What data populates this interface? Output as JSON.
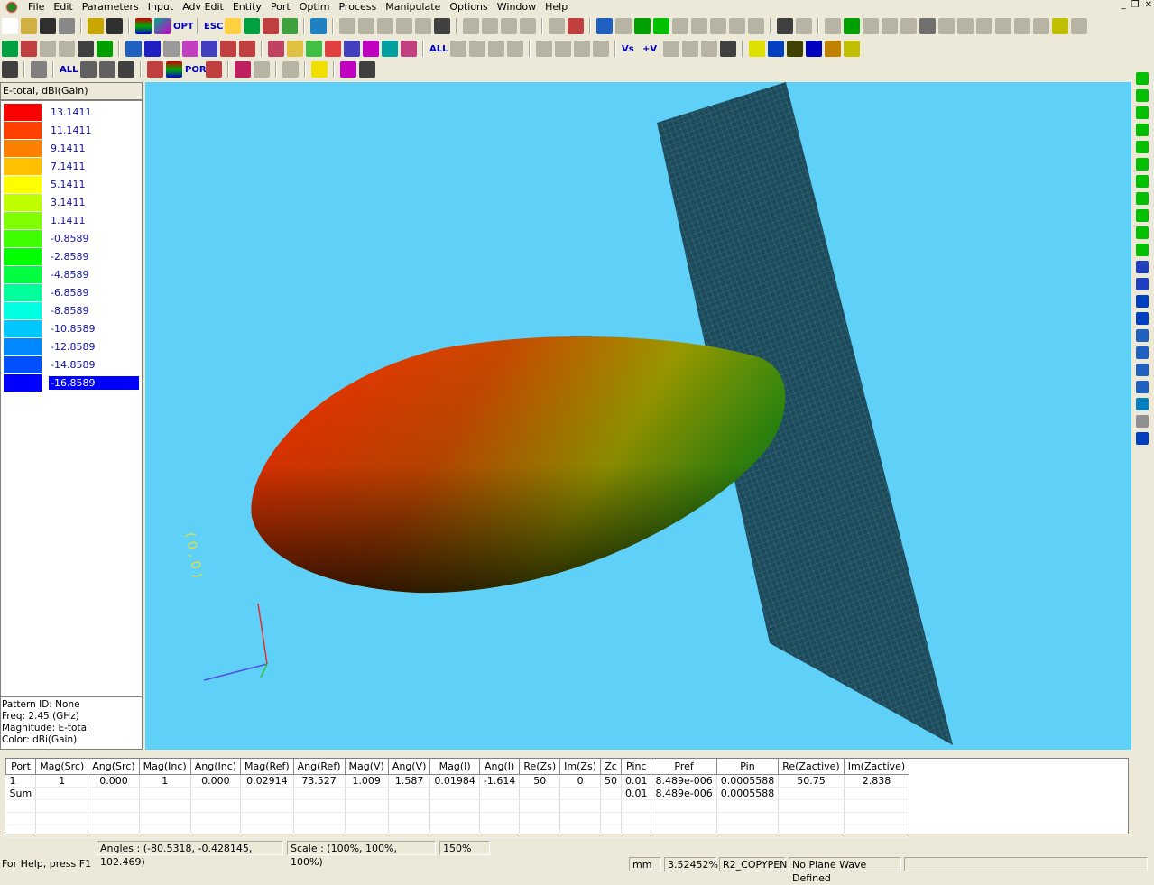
{
  "menu": [
    "File",
    "Edit",
    "Parameters",
    "Input",
    "Adv Edit",
    "Entity",
    "Port",
    "Optim",
    "Process",
    "Manipulate",
    "Options",
    "Window",
    "Help"
  ],
  "toolbar": {
    "opt_label": "OPT",
    "esc_label": "ESC",
    "all_label": "ALL",
    "port_label": "PORT",
    "vs_label": "Vs",
    "v_label": "+V"
  },
  "legend": {
    "title": "E-total, dBi(Gain)",
    "items": [
      {
        "value": "13.1411",
        "color": "#ff0000"
      },
      {
        "value": "11.1411",
        "color": "#ff4000"
      },
      {
        "value": "9.1411",
        "color": "#ff8000"
      },
      {
        "value": "7.1411",
        "color": "#ffc000"
      },
      {
        "value": "5.1411",
        "color": "#ffff00"
      },
      {
        "value": "3.1411",
        "color": "#c0ff00"
      },
      {
        "value": "1.1411",
        "color": "#80ff00"
      },
      {
        "value": "-0.8589",
        "color": "#40ff00"
      },
      {
        "value": "-2.8589",
        "color": "#00ff00"
      },
      {
        "value": "-4.8589",
        "color": "#00ff40"
      },
      {
        "value": "-6.8589",
        "color": "#00ff9a"
      },
      {
        "value": "-8.8589",
        "color": "#00ffe0"
      },
      {
        "value": "-10.8589",
        "color": "#00c8ff"
      },
      {
        "value": "-12.8589",
        "color": "#0088ff"
      },
      {
        "value": "-14.8589",
        "color": "#0050ff"
      },
      {
        "value": "-16.8589",
        "color": "#0000ff",
        "selected": true
      }
    ]
  },
  "info": {
    "pattern": "Pattern ID: None",
    "freq": "Freq: 2.45 (GHz)",
    "magnitude": "Magnitude: E-total",
    "color": "Color: dBi(Gain)"
  },
  "table": {
    "headers": [
      "Port",
      "Mag(Src)",
      "Ang(Src)",
      "Mag(Inc)",
      "Ang(Inc)",
      "Mag(Ref)",
      "Ang(Ref)",
      "Mag(V)",
      "Ang(V)",
      "Mag(I)",
      "Ang(I)",
      "Re(Zs)",
      "Im(Zs)",
      "Zc",
      "Pinc",
      "Pref",
      "Pin",
      "Re(Zactive)",
      "Im(Zactive)"
    ],
    "rows": [
      [
        "1",
        "1",
        "0.000",
        "1",
        "0.000",
        "0.02914",
        "73.527",
        "1.009",
        "1.587",
        "0.01984",
        "-1.614",
        "50",
        "0",
        "50",
        "0.01",
        "8.489e-006",
        "0.0005588",
        "50.75",
        "2.838"
      ],
      [
        "Sum",
        "",
        "",
        "",
        "",
        "",
        "",
        "",
        "",
        "",
        "",
        "",
        "",
        "",
        "0.01",
        "8.489e-006",
        "0.0005588",
        "",
        ""
      ]
    ]
  },
  "status": {
    "angles": "Angles : (-80.5318, -0.428145, 102.469)",
    "scale": "Scale : (100%, 100%, 100%)",
    "zoom": "150%",
    "help": "For Help, press F1",
    "unit": "mm",
    "percent": "3.52452%",
    "pen": "R2_COPYPEN",
    "plane_wave": "No Plane Wave Defined"
  },
  "colors": {
    "viewport_bg": "#5fd1f9",
    "plane": "#1e4a5a"
  }
}
